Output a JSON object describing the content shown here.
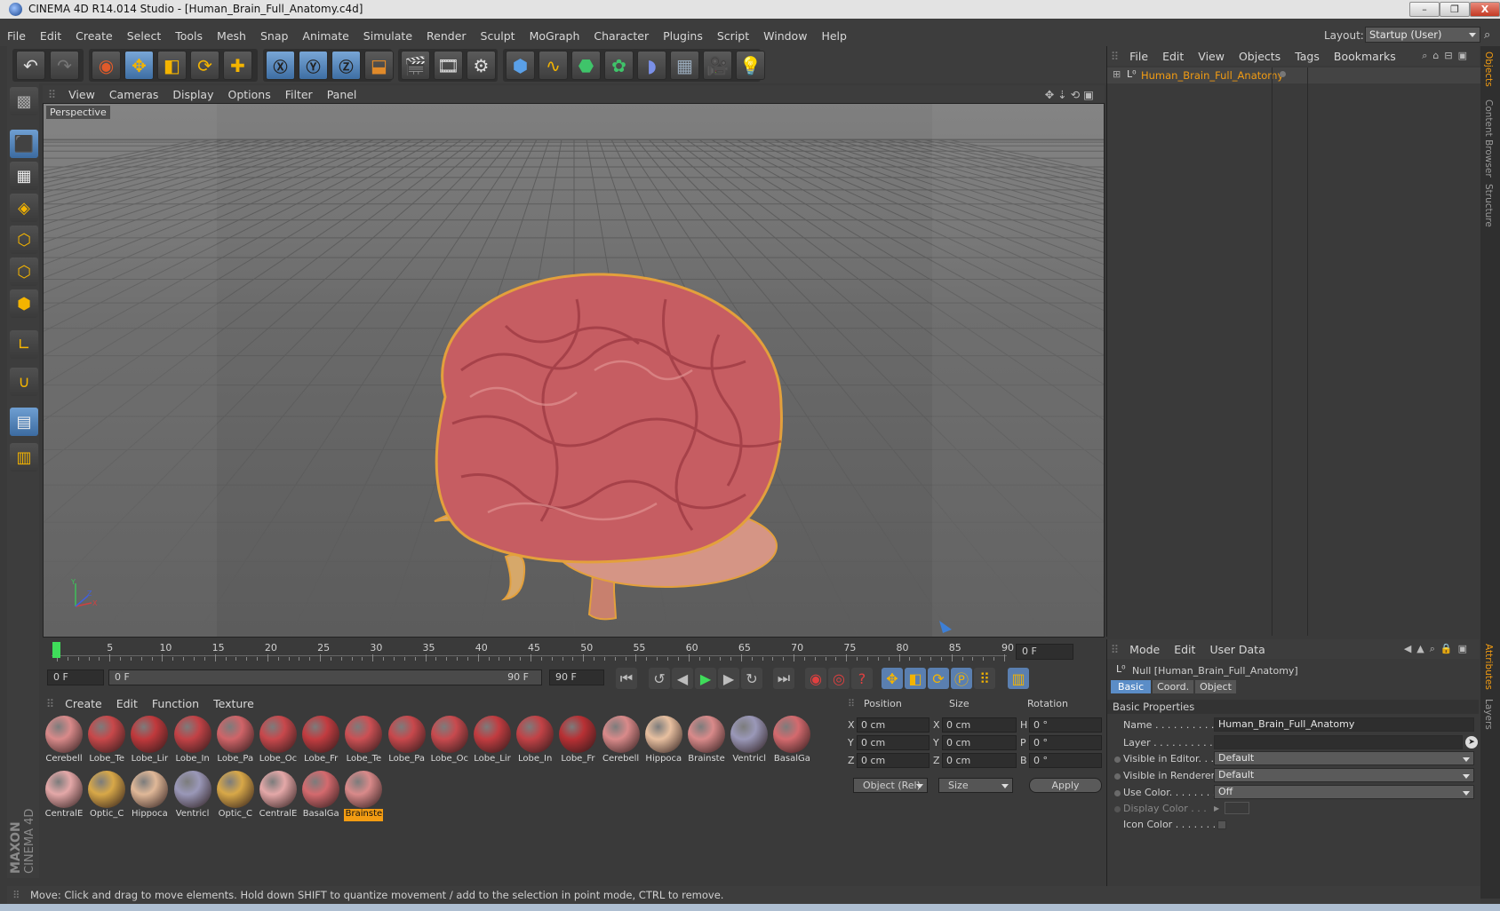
{
  "window": {
    "title": "CINEMA 4D R14.014 Studio - [Human_Brain_Full_Anatomy.c4d]",
    "controls": [
      "–",
      "❐",
      "X"
    ]
  },
  "menubar": [
    "File",
    "Edit",
    "Create",
    "Select",
    "Tools",
    "Mesh",
    "Snap",
    "Animate",
    "Simulate",
    "Render",
    "Sculpt",
    "MoGraph",
    "Character",
    "Plugins",
    "Script",
    "Window",
    "Help"
  ],
  "layout": {
    "label": "Layout:",
    "value": "Startup (User)"
  },
  "viewport": {
    "menu": [
      "View",
      "Cameras",
      "Display",
      "Options",
      "Filter",
      "Panel"
    ],
    "label": "Perspective",
    "axis_labels": {
      "y": "Y",
      "x": "X",
      "z": "Z"
    }
  },
  "timeline": {
    "ticks": [
      "0",
      "5",
      "10",
      "15",
      "20",
      "25",
      "30",
      "35",
      "40",
      "45",
      "50",
      "55",
      "60",
      "65",
      "70",
      "75",
      "80",
      "85",
      "90"
    ],
    "current_frame": "0 F",
    "start_field": "0 F",
    "range_start": "0 F",
    "range_end": "90 F",
    "end_field": "90 F"
  },
  "materials": {
    "menu": [
      "Create",
      "Edit",
      "Function",
      "Texture"
    ],
    "items": [
      {
        "label": "Cerebell",
        "color": "#d98a8a"
      },
      {
        "label": "Lobe_Te",
        "color": "#c8484a"
      },
      {
        "label": "Lobe_Lir",
        "color": "#c0393c"
      },
      {
        "label": "Lobe_In",
        "color": "#c24246"
      },
      {
        "label": "Lobe_Pa",
        "color": "#d06468"
      },
      {
        "label": "Lobe_Oc",
        "color": "#c8484c"
      },
      {
        "label": "Lobe_Fr",
        "color": "#c23c40"
      },
      {
        "label": "Lobe_Te",
        "color": "#cc5054"
      },
      {
        "label": "Lobe_Pa",
        "color": "#c8484c"
      },
      {
        "label": "Lobe_Oc",
        "color": "#c84a4e"
      },
      {
        "label": "Lobe_Lir",
        "color": "#c23c40"
      },
      {
        "label": "Lobe_In",
        "color": "#c24246"
      },
      {
        "label": "Lobe_Fr",
        "color": "#b83034"
      },
      {
        "label": "Cerebell",
        "color": "#d98a8a"
      },
      {
        "label": "Hippoca",
        "color": "#e8c0a0"
      },
      {
        "label": "Brainste",
        "color": "#d98a8a"
      },
      {
        "label": "Ventricl",
        "color": "#9a98b8"
      },
      {
        "label": "BasalGa",
        "color": "#d46a6e"
      },
      {
        "label": "CentralE",
        "color": "#e4a8a8"
      },
      {
        "label": "Optic_C",
        "color": "#d8a848"
      },
      {
        "label": "Hippoca",
        "color": "#e0b898"
      },
      {
        "label": "Ventricl",
        "color": "#9a98b8"
      },
      {
        "label": "Optic_C",
        "color": "#d8a848"
      },
      {
        "label": "CentralE",
        "color": "#e4a8a8"
      },
      {
        "label": "BasalGa",
        "color": "#d46a6e"
      },
      {
        "label": "Brainste",
        "color": "#d98a8a",
        "selected": true
      }
    ]
  },
  "coords": {
    "headers": {
      "position": "Position",
      "size": "Size",
      "rotation": "Rotation"
    },
    "rows": [
      {
        "axis": "X",
        "pos": "0 cm",
        "saxis": "X",
        "size": "0 cm",
        "raxis": "H",
        "rot": "0 °"
      },
      {
        "axis": "Y",
        "pos": "0 cm",
        "saxis": "Y",
        "size": "0 cm",
        "raxis": "P",
        "rot": "0 °"
      },
      {
        "axis": "Z",
        "pos": "0 cm",
        "saxis": "Z",
        "size": "0 cm",
        "raxis": "B",
        "rot": "0 °"
      }
    ],
    "mode_select": "Object (Rel)",
    "size_select": "Size",
    "apply": "Apply"
  },
  "objects": {
    "menu": [
      "File",
      "Edit",
      "View",
      "Objects",
      "Tags",
      "Bookmarks"
    ],
    "items": [
      {
        "name": "Human_Brain_Full_Anatomy"
      }
    ]
  },
  "attributes": {
    "menu": [
      "Mode",
      "Edit",
      "User Data"
    ],
    "object_title": "Null [Human_Brain_Full_Anatomy]",
    "tabs": [
      "Basic",
      "Coord.",
      "Object"
    ],
    "section": "Basic Properties",
    "rows": [
      {
        "label": "Name . . . . . . . . . . .",
        "value": "Human_Brain_Full_Anatomy"
      },
      {
        "label": "Layer . . . . . . . . . . .",
        "value": ""
      },
      {
        "label": "Visible in Editor. . .",
        "value": "Default"
      },
      {
        "label": "Visible in Renderer",
        "value": "Default"
      },
      {
        "label": "Use Color. . . . . . . .",
        "value": "Off"
      },
      {
        "label": "Display Color . . .",
        "value": ""
      },
      {
        "label": "Icon Color . . . . . . .",
        "value": ""
      }
    ]
  },
  "sidetabs": [
    "Objects",
    "Content Browser",
    "Structure",
    "Attributes",
    "Layers"
  ],
  "status": "Move: Click and drag to move elements. Hold down SHIFT to quantize movement / add to the selection in point mode, CTRL to remove.",
  "brand": {
    "maxon": "MAXON",
    "cinema": "CINEMA 4D"
  },
  "colors": {
    "accent": "#f39c12",
    "selection_blue": "#5b8dc7"
  }
}
